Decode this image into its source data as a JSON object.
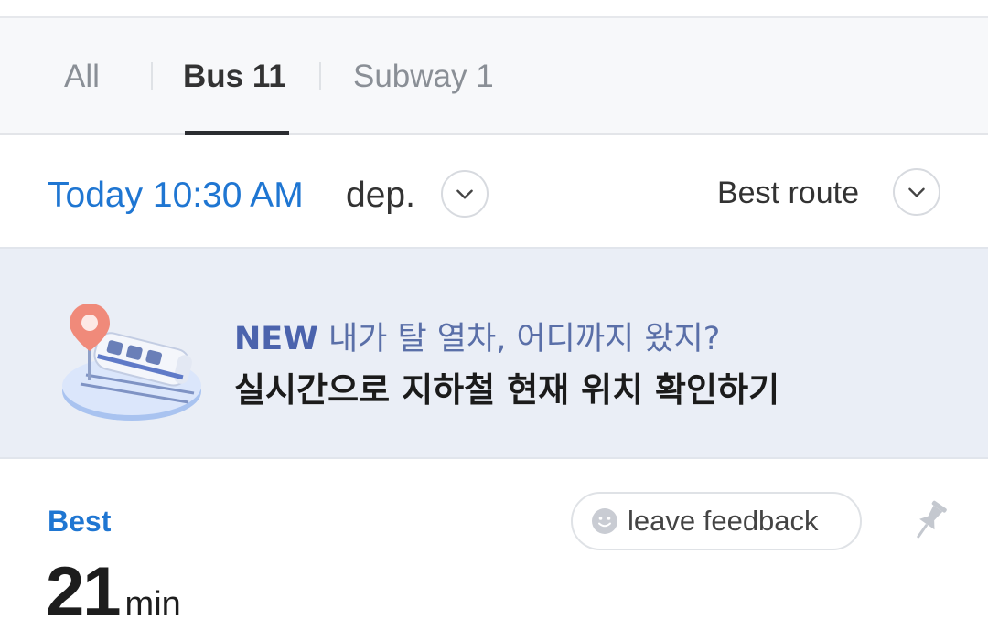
{
  "tabs": {
    "items": [
      {
        "label": "All"
      },
      {
        "label": "Bus 11"
      },
      {
        "label": "Subway 1"
      }
    ],
    "selected": "Bus 11"
  },
  "departure": {
    "time": "Today 10:30 AM",
    "suffix": "dep."
  },
  "sort": {
    "label": "Best route"
  },
  "banner": {
    "badge": "NEW",
    "line1": "내가 탈 열차, 어디까지 왔지?",
    "line2": "실시간으로 지하철 현재 위치 확인하기",
    "icon": "train-map-pin-illustration"
  },
  "route": {
    "tag": "Best",
    "feedback_label": "leave feedback",
    "duration_value": "21",
    "duration_unit": "min"
  },
  "colors": {
    "accent": "#1f76d2",
    "banner_bg": "#eaeef6",
    "banner_badge": "#4b63ad"
  }
}
